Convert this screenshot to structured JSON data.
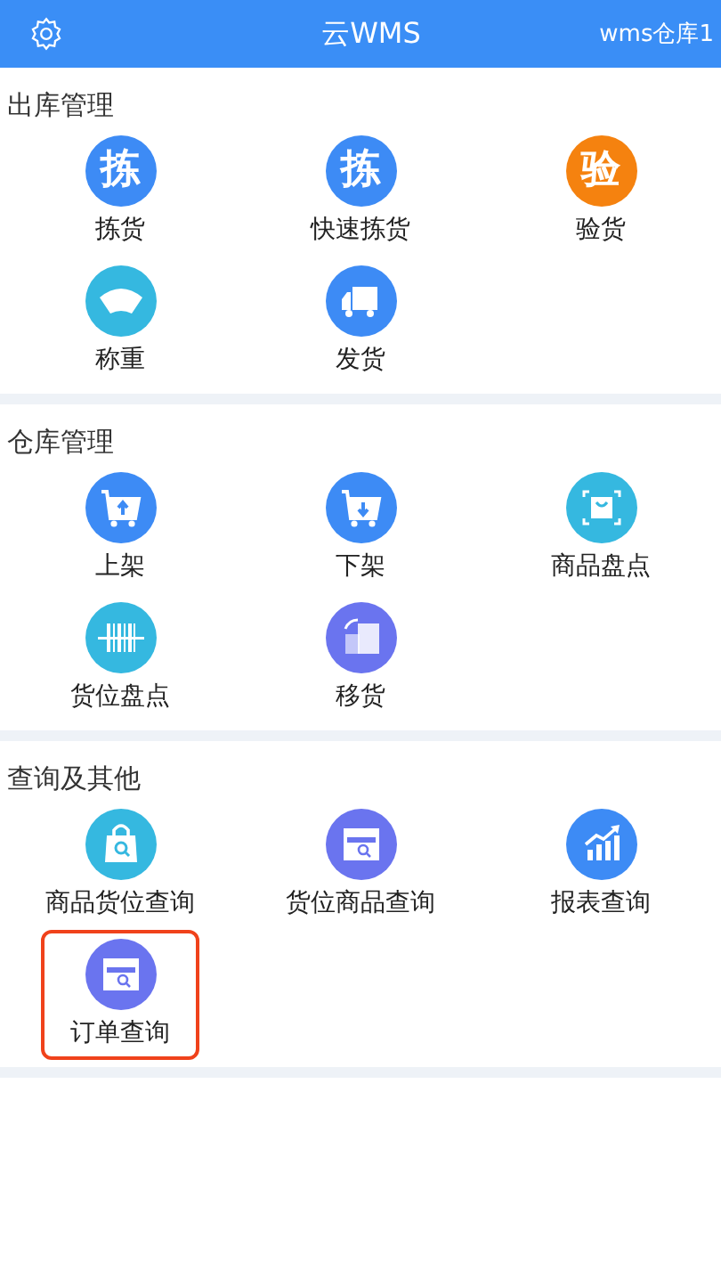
{
  "header": {
    "title": "云WMS",
    "warehouse": "wms仓库1"
  },
  "sections": [
    {
      "title": "出库管理",
      "items": [
        {
          "label": "拣货",
          "kind": "glyph",
          "glyph": "拣",
          "color": "#3d8bf5",
          "selected": false
        },
        {
          "label": "快速拣货",
          "kind": "glyph",
          "glyph": "拣",
          "color": "#3d8bf5",
          "selected": false
        },
        {
          "label": "验货",
          "kind": "glyph",
          "glyph": "验",
          "color": "#f5820f",
          "selected": false
        },
        {
          "label": "称重",
          "kind": "scale",
          "color": "#35b8e0",
          "selected": false
        },
        {
          "label": "发货",
          "kind": "truck",
          "color": "#3d8bf5",
          "selected": false
        }
      ]
    },
    {
      "title": "仓库管理",
      "items": [
        {
          "label": "上架",
          "kind": "cart-up",
          "color": "#3d8bf5",
          "selected": false
        },
        {
          "label": "下架",
          "kind": "cart-down",
          "color": "#3d8bf5",
          "selected": false
        },
        {
          "label": "商品盘点",
          "kind": "scan-bag",
          "color": "#35b8e0",
          "selected": false
        },
        {
          "label": "货位盘点",
          "kind": "barcode",
          "color": "#35b8e0",
          "selected": false
        },
        {
          "label": "移货",
          "kind": "move",
          "color": "#6a74ef",
          "selected": false
        }
      ]
    },
    {
      "title": "查询及其他",
      "items": [
        {
          "label": "商品货位查询",
          "kind": "bag-search",
          "color": "#35b8e0",
          "selected": false
        },
        {
          "label": "货位商品查询",
          "kind": "shelf-search",
          "color": "#6a74ef",
          "selected": false
        },
        {
          "label": "报表查询",
          "kind": "chart",
          "color": "#3d8bf5",
          "selected": false
        },
        {
          "label": "订单查询",
          "kind": "shelf-search",
          "color": "#6a74ef",
          "selected": true
        }
      ]
    }
  ]
}
